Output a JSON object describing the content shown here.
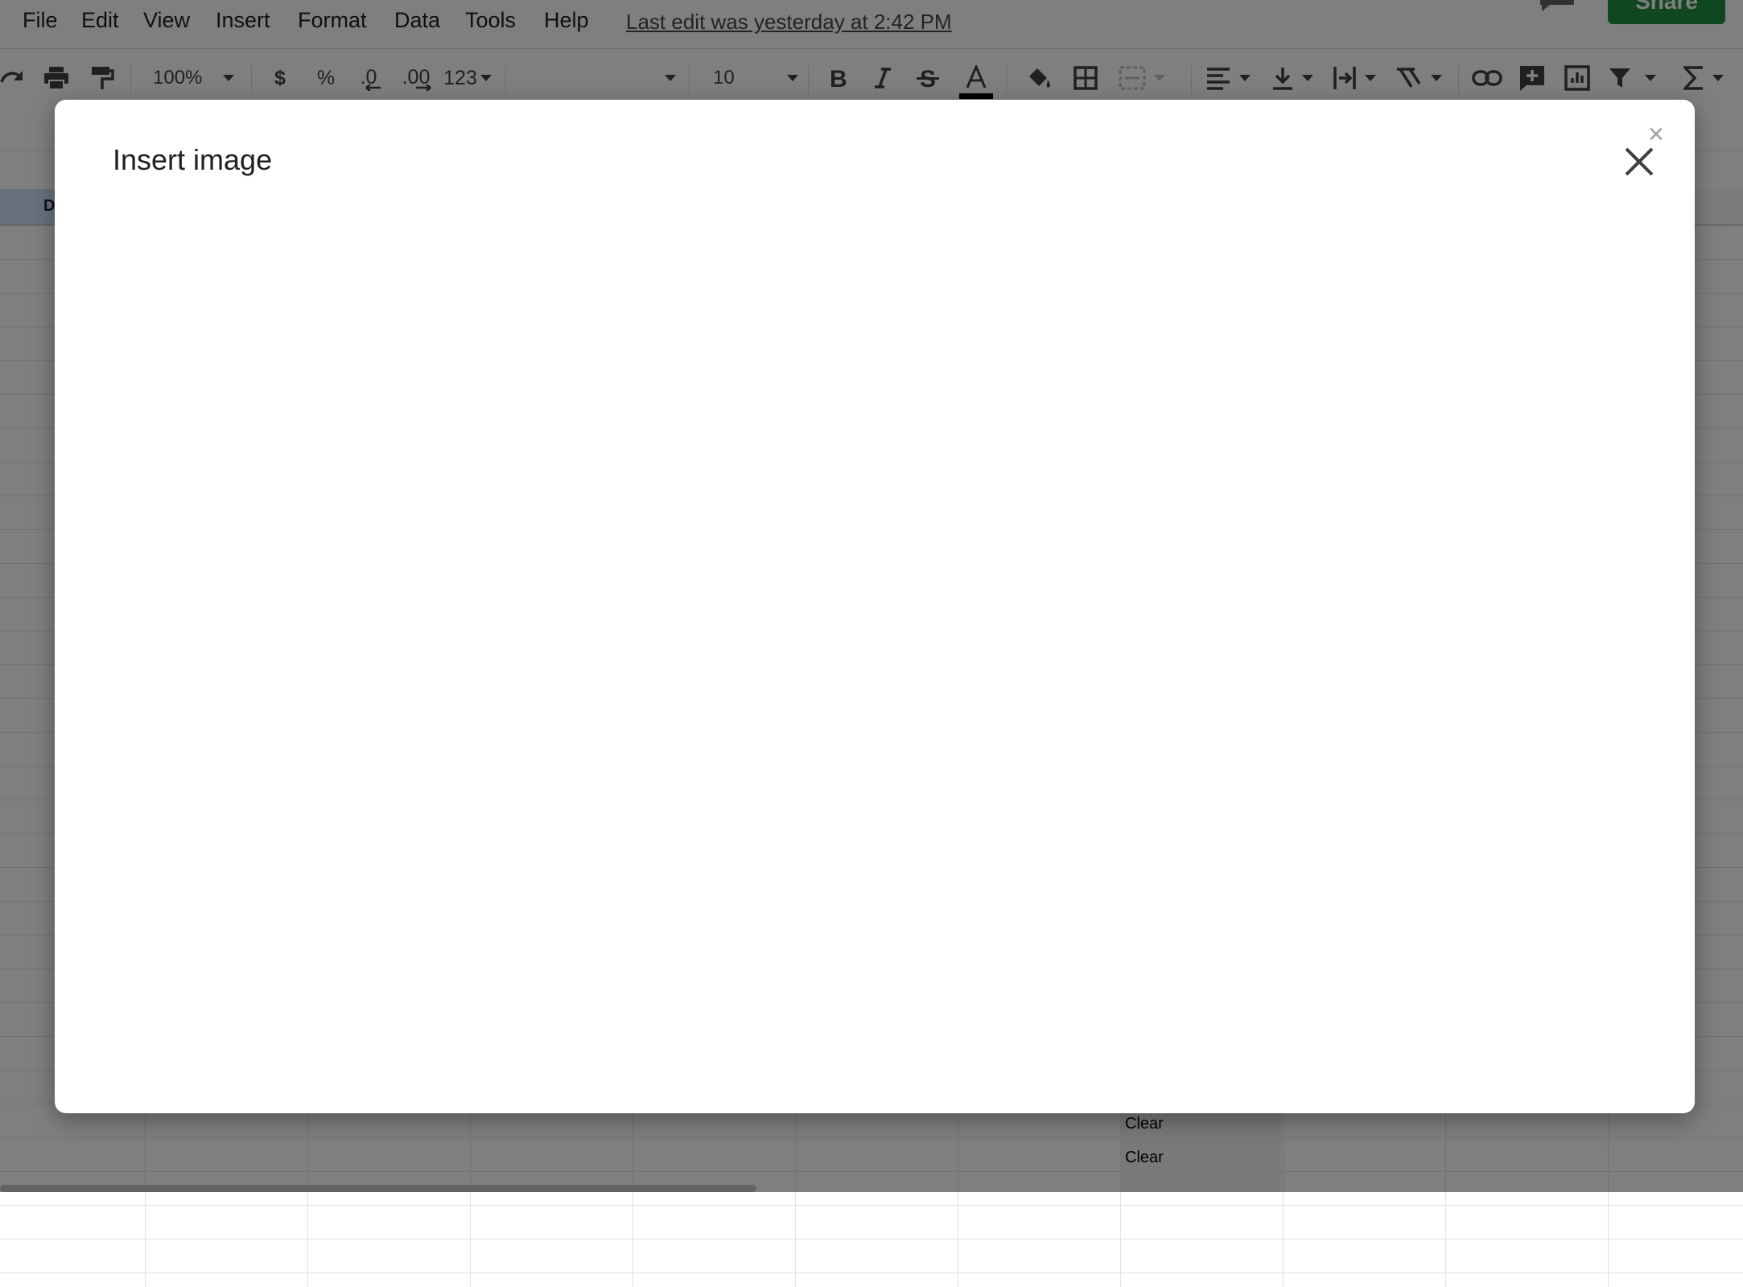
{
  "menu": {
    "items": [
      "File",
      "Edit",
      "View",
      "Insert",
      "Format",
      "Data",
      "Tools",
      "Help"
    ],
    "last_edit": "Last edit was yesterday at 2:42 PM"
  },
  "share_label": "Share",
  "toolbar": {
    "zoom": "100%",
    "currency": "$",
    "percent": "%",
    "decrease_decimal": ".0",
    "increase_decimal": ".00",
    "more_formats": "123",
    "font_name": "",
    "font_size": "10"
  },
  "sheet": {
    "column_header_partial": "D",
    "cells": [
      "Clear",
      "Clear"
    ]
  },
  "dialog": {
    "title": "Insert image",
    "close_small_glyph": "×"
  },
  "colors": {
    "share_green": "#1e8e3e",
    "overlay": "rgba(0,0,0,0.5)",
    "text_color_bar": "#000000"
  }
}
